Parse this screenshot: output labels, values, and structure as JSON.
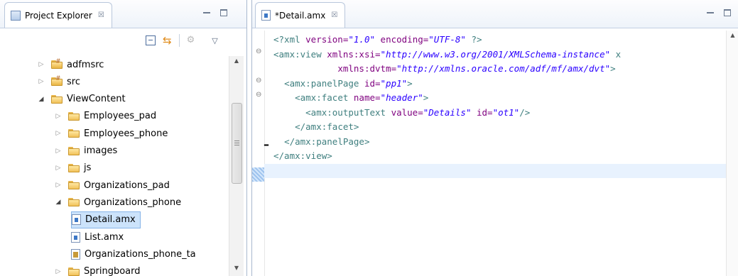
{
  "project_explorer": {
    "title": "Project Explorer",
    "close_label": "☒",
    "tree": [
      {
        "label": "adfmsrc",
        "kind": "srcfolder",
        "expanded": false,
        "level": 1
      },
      {
        "label": "src",
        "kind": "srcfolder",
        "expanded": false,
        "level": 1
      },
      {
        "label": "ViewContent",
        "kind": "folder",
        "expanded": true,
        "level": 1
      },
      {
        "label": "Employees_pad",
        "kind": "folder",
        "expanded": false,
        "level": 2
      },
      {
        "label": "Employees_phone",
        "kind": "folder",
        "expanded": false,
        "level": 2
      },
      {
        "label": "images",
        "kind": "folder",
        "expanded": false,
        "level": 2
      },
      {
        "label": "js",
        "kind": "folder",
        "expanded": false,
        "level": 2
      },
      {
        "label": "Organizations_pad",
        "kind": "folder",
        "expanded": false,
        "level": 2
      },
      {
        "label": "Organizations_phone",
        "kind": "folder",
        "expanded": true,
        "level": 2
      },
      {
        "label": "Detail.amx",
        "kind": "file",
        "selected": true,
        "level": 3
      },
      {
        "label": "List.amx",
        "kind": "file",
        "level": 3
      },
      {
        "label": "Organizations_phone_ta",
        "kind": "taskflow",
        "level": 3
      },
      {
        "label": "Springboard",
        "kind": "folder",
        "expanded": false,
        "level": 2
      }
    ]
  },
  "editor": {
    "tab_title": "*Detail.amx",
    "close_label": "☒",
    "lines": [
      {
        "fold": false,
        "html": "<span class='pi'>&lt;?xml </span><span class='attr'>version=</span><span class='val'>\"1.0\"</span><span class='attr'> encoding=</span><span class='val'>\"UTF-8\"</span><span class='pi'> ?&gt;</span>",
        "indent": 0
      },
      {
        "fold": true,
        "html": "<span class='tag'>&lt;amx:view </span><span class='attr'>xmlns:xsi=</span><span class='val'>\"http://www.w3.org/2001/XMLSchema-instance\"</span><span class='tag'> x</span>",
        "indent": 0
      },
      {
        "fold": false,
        "html": "            <span class='attr'>xmlns:dvtm=</span><span class='val'>\"http://xmlns.oracle.com/adf/mf/amx/dvt\"</span><span class='tag'>&gt;</span>",
        "indent": 0
      },
      {
        "fold": true,
        "html": "  <span class='tag'>&lt;amx:panelPage </span><span class='attr'>id=</span><span class='val'>\"pp1\"</span><span class='tag'>&gt;</span>",
        "indent": 0
      },
      {
        "fold": true,
        "html": "    <span class='tag'>&lt;amx:facet </span><span class='attr'>name=</span><span class='val'>\"header\"</span><span class='tag'>&gt;</span>",
        "indent": 0
      },
      {
        "fold": false,
        "html": "      <span class='tag'>&lt;amx:outputText </span><span class='attr'>value=</span><span class='val'>\"Details\"</span><span class='attr'> id=</span><span class='val'>\"ot1\"</span><span class='tag'>/&gt;</span>",
        "indent": 0
      },
      {
        "fold": false,
        "html": "    <span class='tag'>&lt;/amx:facet&gt;</span>",
        "indent": 0
      },
      {
        "fold": false,
        "html": "  <span class='tag'>&lt;/amx:panelPage&gt;</span>",
        "indent": 0
      },
      {
        "fold": false,
        "html": "<span class='tag'>&lt;/amx:view&gt;</span>",
        "indent": 0
      },
      {
        "fold": false,
        "html": "",
        "indent": 0,
        "current": true
      }
    ]
  }
}
